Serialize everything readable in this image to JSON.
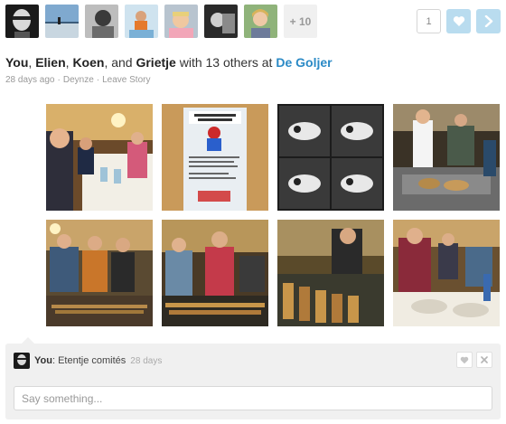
{
  "avatars": {
    "more_label": "+ 10"
  },
  "actions": {
    "like_count": "1"
  },
  "story": {
    "actor_you": "You",
    "actor_2": "Elien",
    "actor_3": "Koen",
    "and_text": "and",
    "actor_4": "Grietje",
    "with_text": "with 13 others at",
    "place": "De Goljer",
    "time": "28 days ago",
    "location": "Deynze",
    "leave_label": "Leave Story"
  },
  "comment": {
    "author": "You",
    "text": "Etentje comités",
    "time": "28 days",
    "input_placeholder": "Say something..."
  },
  "colors": {
    "link_blue": "#2b8ac6",
    "button_blue": "#b9dcef"
  }
}
